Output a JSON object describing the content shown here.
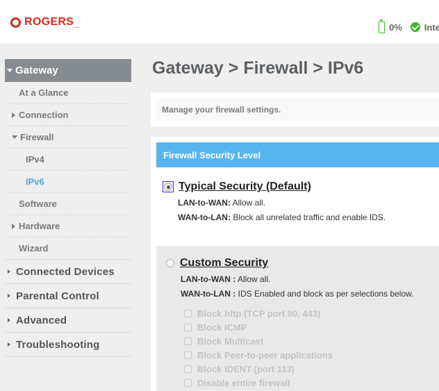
{
  "header": {
    "brand": "ROGERS",
    "brand_suffix": "_",
    "battery_value": "0%",
    "internet_label": "Inte"
  },
  "sidebar": {
    "top": {
      "label": "Gateway",
      "expanded": true
    },
    "sub_items": [
      {
        "label": "At a Glance",
        "arrow": "none",
        "level": 1
      },
      {
        "label": "Connection",
        "arrow": "right",
        "level": 1
      },
      {
        "label": "Firewall",
        "arrow": "down",
        "level": 1
      },
      {
        "label": "IPv4",
        "arrow": "none",
        "level": 2
      },
      {
        "label": "IPv6",
        "arrow": "none",
        "level": 2,
        "active": true
      },
      {
        "label": "Software",
        "arrow": "none",
        "level": 1
      },
      {
        "label": "Hardware",
        "arrow": "right",
        "level": 1
      },
      {
        "label": "Wizard",
        "arrow": "none",
        "level": 1
      }
    ],
    "main_items": [
      {
        "label": "Connected Devices"
      },
      {
        "label": "Parental Control"
      },
      {
        "label": "Advanced"
      },
      {
        "label": "Troubleshooting"
      }
    ]
  },
  "main": {
    "title": "Gateway > Firewall > IPv6",
    "intro": "Manage your firewall settings.",
    "panel_title": "Firewall Security Level",
    "typical": {
      "title": "Typical Security (Default)",
      "selected": true,
      "lan_label": "LAN-to-WAN:",
      "lan_value": " Allow all.",
      "wan_label": "WAN-to-LAN:",
      "wan_value": " Block all unrelated traffic and enable IDS."
    },
    "custom": {
      "title": "Custom Security",
      "selected": false,
      "lan_label": "LAN-to-WAN :",
      "lan_value": " Allow all.",
      "wan_label": "WAN-to-LAN :",
      "wan_value": " IDS Enabled and block as per selections below.",
      "checkboxes": [
        {
          "label": "Block http (TCP port 80, 443)",
          "checked": false,
          "disabled": true
        },
        {
          "label": "Block ICMP",
          "checked": false,
          "disabled": true
        },
        {
          "label": "Block Multicast",
          "checked": false,
          "disabled": true
        },
        {
          "label": "Block Peer-to-peer applications",
          "checked": false,
          "disabled": true
        },
        {
          "label": "Block IDENT (port 113)",
          "checked": false,
          "disabled": true
        },
        {
          "label": "Disable entire firewall",
          "checked": false,
          "disabled": true
        }
      ]
    }
  },
  "colors": {
    "brand_red": "#d52b1e",
    "accent_blue": "#56b5ee",
    "active_link": "#4aa9e2",
    "status_green": "#35b72d",
    "nav_active_bg": "#868b90"
  }
}
